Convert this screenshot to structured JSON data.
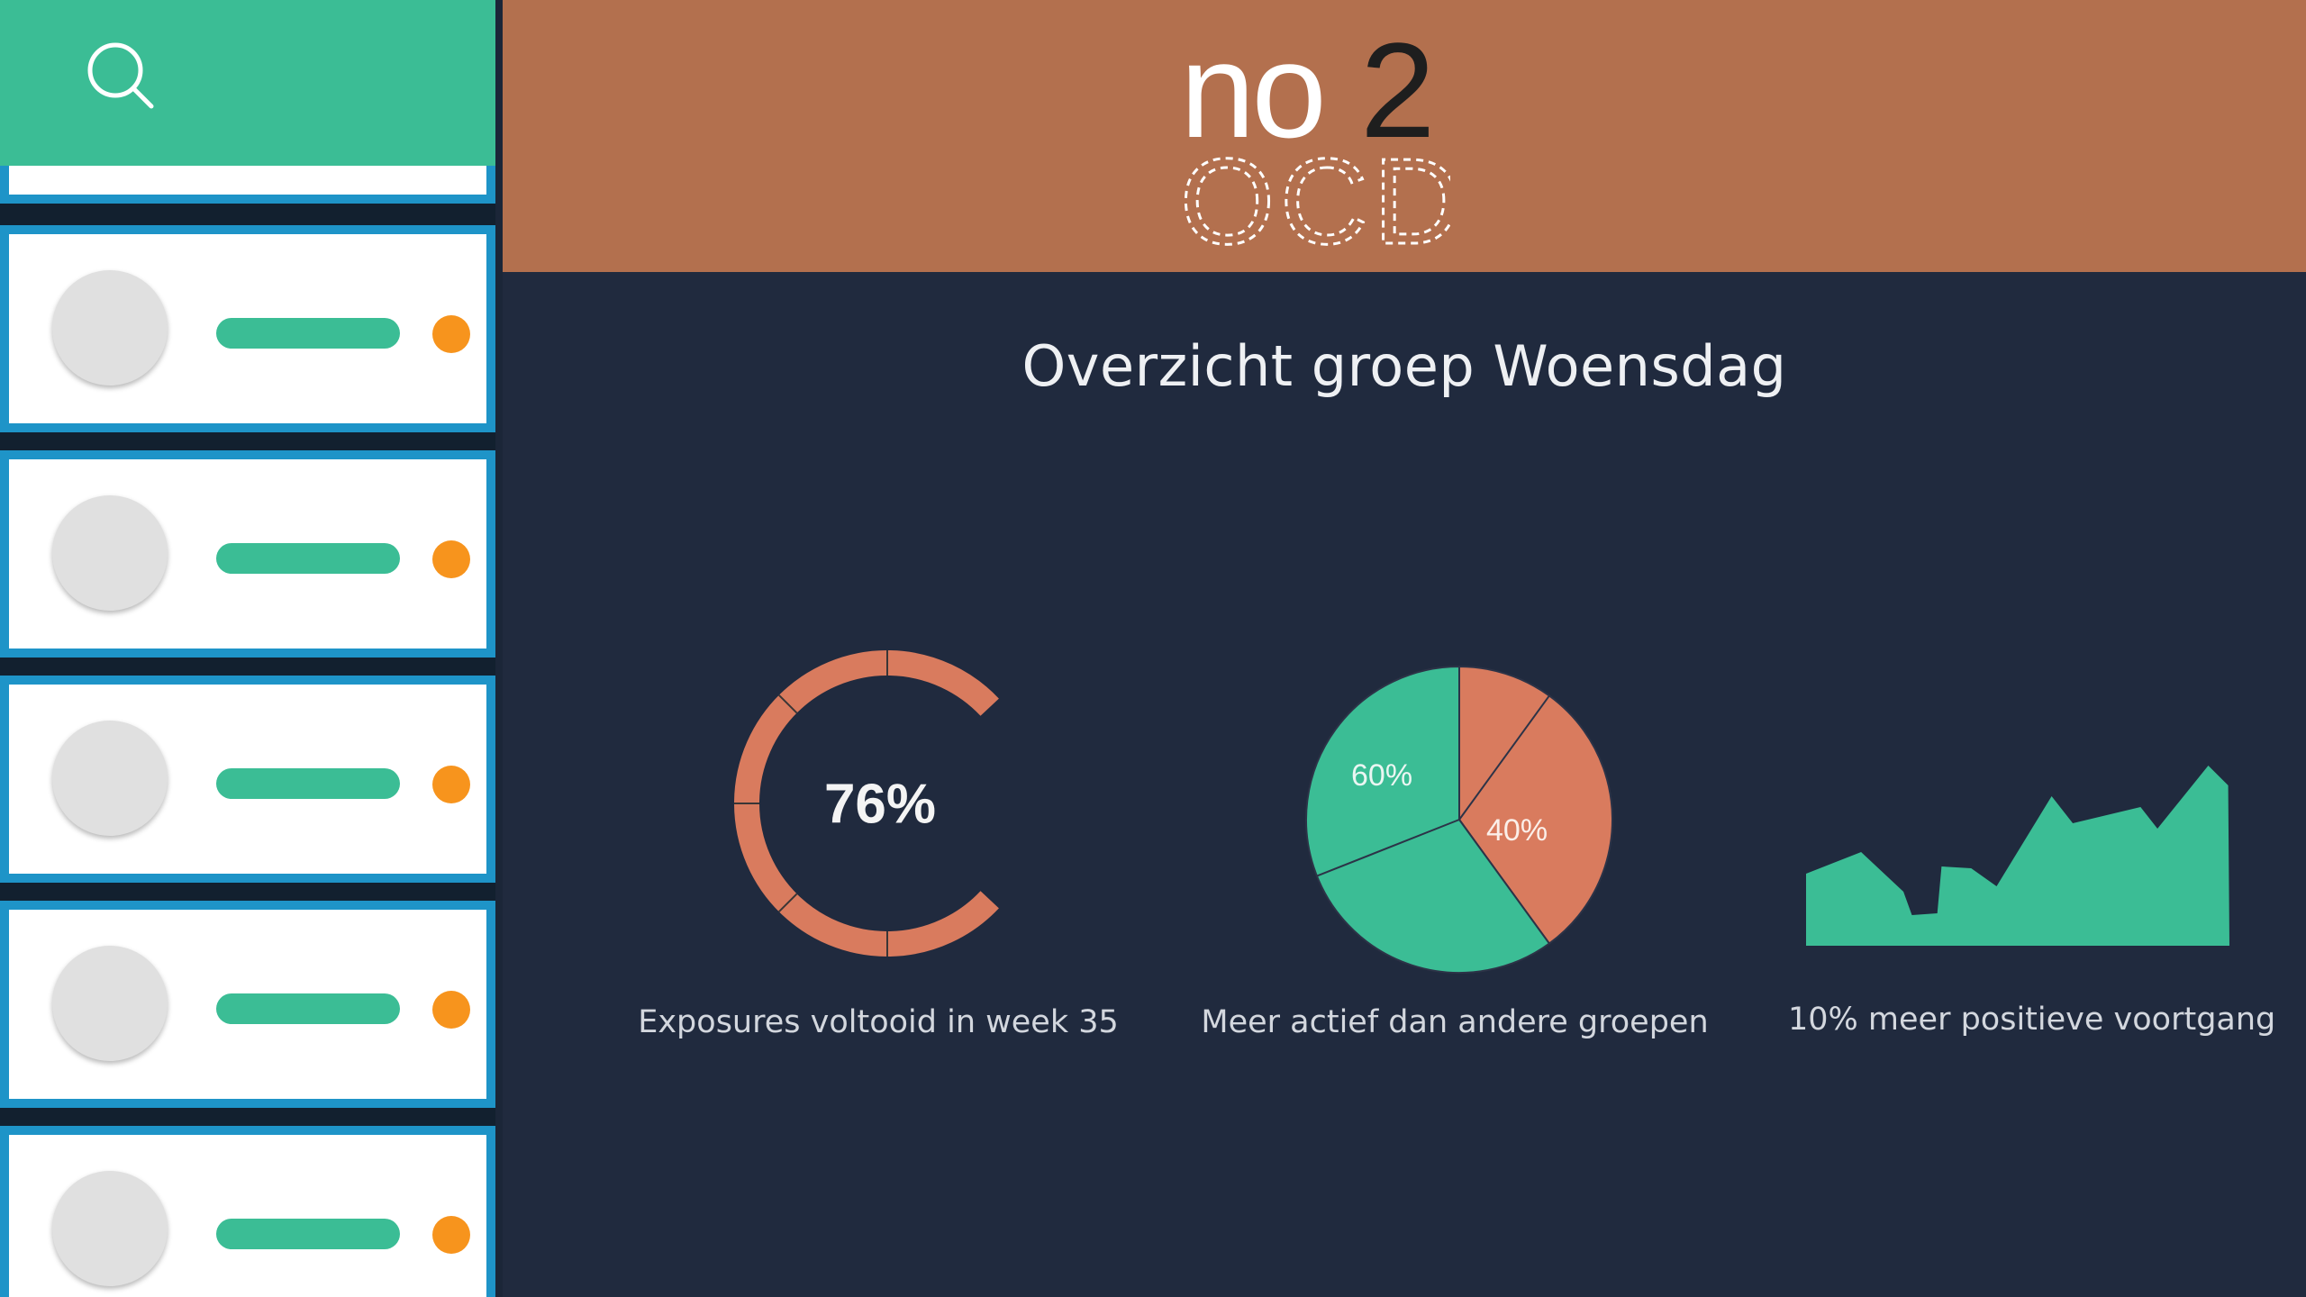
{
  "colors": {
    "sidebar_header": "#3bbd95",
    "card_border": "#1e94c8",
    "status_dot": "#f7941d",
    "header": "#b3704e",
    "background": "#202a3e",
    "chart_orange": "#d97b5e",
    "chart_green": "#3bbd95"
  },
  "sidebar": {
    "search_icon": "search-icon",
    "cards": [
      {
        "status": "orange"
      },
      {
        "status": "orange"
      },
      {
        "status": "orange"
      },
      {
        "status": "orange"
      },
      {
        "status": "orange"
      }
    ]
  },
  "header": {
    "logo_line1": "no2",
    "logo_line2": "OCD"
  },
  "page": {
    "title": "Overzicht groep Woensdag"
  },
  "chart_data": [
    {
      "type": "gauge",
      "value": 76,
      "label": "76%",
      "caption": "Exposures voltooid in week 35"
    },
    {
      "type": "pie",
      "slices": [
        {
          "label": "40%",
          "value": 40,
          "color": "#d97b5e"
        },
        {
          "label": "60%",
          "value": 60,
          "color": "#3bbd95"
        }
      ],
      "caption": "Meer actief dan andere groepen"
    },
    {
      "type": "area",
      "values": [
        0.4,
        0.52,
        0.3,
        0.17,
        0.18,
        0.44,
        0.43,
        0.33,
        0.83,
        0.68,
        0.77,
        0.65,
        1.0,
        0.89
      ],
      "caption": "10% meer positieve voortgang"
    }
  ]
}
